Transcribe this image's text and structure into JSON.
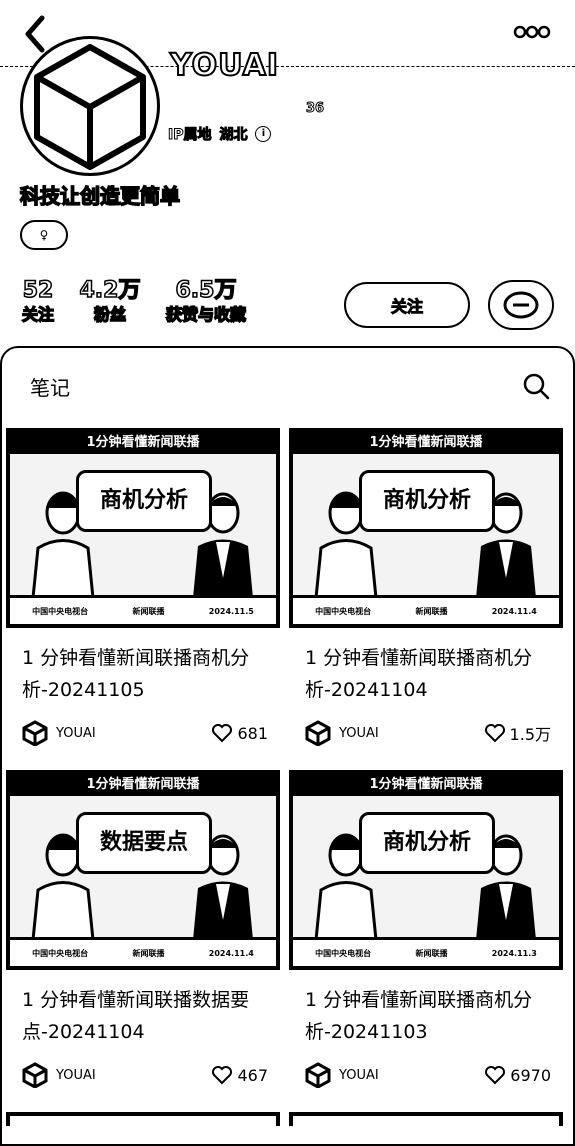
{
  "header": {
    "back_icon": "chevron-left-icon",
    "more_icon": "more-dots-icon"
  },
  "profile": {
    "name": "YOUAI",
    "id_text": "36",
    "ip_label": "IP属地",
    "ip_location": "湖北",
    "bio": "科技让创造更简单",
    "gender_badge": "♀"
  },
  "stats": [
    {
      "value": "52",
      "label": "关注"
    },
    {
      "value": "4.2万",
      "label": "粉丝"
    },
    {
      "value": "6.5万",
      "label": "获赞与收藏"
    }
  ],
  "actions": {
    "follow_label": "关注",
    "message_icon": "chat-bubble-icon"
  },
  "tabs": {
    "active_label": "笔记",
    "search_icon": "search-icon"
  },
  "notes": [
    {
      "banner": "1分钟看懂新闻联播",
      "overlay": "商机分析",
      "channel": "中国中央电视台",
      "program": "新闻联播",
      "date": "2024.11.5",
      "title": "1 分钟看懂新闻联播商机分析-20241105",
      "author": "YOUAI",
      "likes": "681"
    },
    {
      "banner": "1分钟看懂新闻联播",
      "overlay": "商机分析",
      "channel": "中国中央电视台",
      "program": "新闻联播",
      "date": "2024.11.4",
      "title": "1 分钟看懂新闻联播商机分析-20241104",
      "author": "YOUAI",
      "likes": "1.5万"
    },
    {
      "banner": "1分钟看懂新闻联播",
      "overlay": "数据要点",
      "channel": "中国中央电视台",
      "program": "新闻联播",
      "date": "2024.11.4",
      "title": "1 分钟看懂新闻联播数据要点-20241104",
      "author": "YOUAI",
      "likes": "467"
    },
    {
      "banner": "1分钟看懂新闻联播",
      "overlay": "商机分析",
      "channel": "中国中央电视台",
      "program": "新闻联播",
      "date": "2024.11.3",
      "title": "1 分钟看懂新闻联播商机分析-20241103",
      "author": "YOUAI",
      "likes": "6970"
    }
  ]
}
